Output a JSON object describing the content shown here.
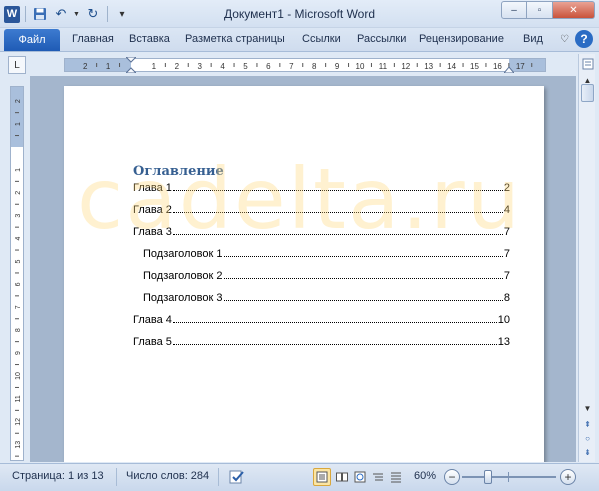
{
  "window": {
    "title": "Документ1  -  Microsoft Word",
    "minimize": "–",
    "maximize": "▫",
    "close": "✕"
  },
  "quick_access": {
    "app_icon": "W",
    "save_icon": "💾",
    "undo_icon": "↶",
    "redo_icon": "↻",
    "customize_icon": "▾"
  },
  "ribbon": {
    "file_tab": "Файл",
    "tabs": [
      "Главная",
      "Вставка",
      "Разметка страницы",
      "Ссылки",
      "Рассылки",
      "Рецензирование",
      "Вид"
    ],
    "minimize_icon": "♡",
    "help_icon": "?"
  },
  "ruler": {
    "corner_icon": "L",
    "h_labels": [
      "2",
      "1",
      "1",
      "2",
      "3",
      "4",
      "5",
      "6",
      "7",
      "8",
      "9",
      "10",
      "11",
      "12",
      "13",
      "14",
      "15",
      "16",
      "17"
    ],
    "v_labels": [
      "2",
      "1",
      "1",
      "2",
      "3",
      "4",
      "5",
      "6",
      "7",
      "8",
      "9",
      "10",
      "11",
      "12",
      "13"
    ]
  },
  "document": {
    "toc_heading": "Оглавление",
    "toc_entries": [
      {
        "title": "Глава 1",
        "page": "2",
        "level": 1
      },
      {
        "title": "Глава 2",
        "page": "4",
        "level": 1
      },
      {
        "title": "Глава 3",
        "page": "7",
        "level": 1
      },
      {
        "title": "Подзаголовок 1",
        "page": "7",
        "level": 2
      },
      {
        "title": "Подзаголовок 2",
        "page": "7",
        "level": 2
      },
      {
        "title": "Подзаголовок 3",
        "page": "8",
        "level": 2
      },
      {
        "title": "Глава 4",
        "page": "10",
        "level": 1
      },
      {
        "title": "Глава 5",
        "page": "13",
        "level": 1
      }
    ],
    "watermark": "cadelta.ru"
  },
  "scrollbar": {
    "up": "▲",
    "down": "▼",
    "prev_page": "⇞",
    "browse": "○",
    "next_page": "⇟"
  },
  "status": {
    "page": "Страница: 1 из 13",
    "words": "Число слов: 284",
    "zoom": "60%",
    "zoom_out": "−",
    "zoom_in": "+",
    "zoom_value": 60
  }
}
